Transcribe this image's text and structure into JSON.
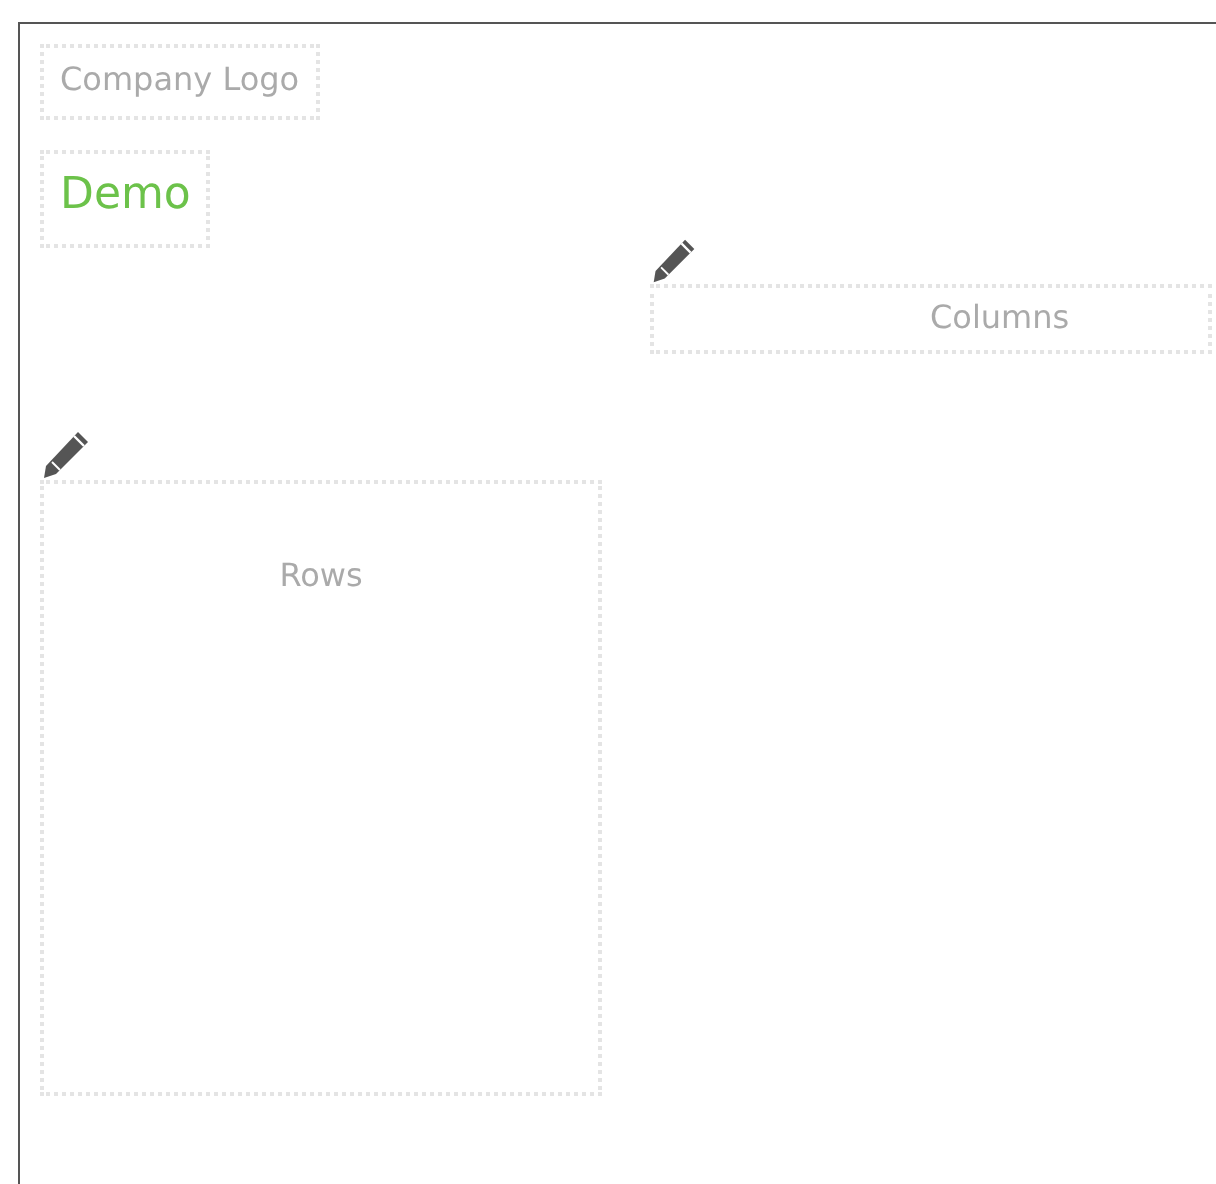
{
  "logo": {
    "text": "Company Logo"
  },
  "title": "Demo",
  "columns_zone": {
    "label": "Columns"
  },
  "rows_zone": {
    "label": "Rows"
  }
}
